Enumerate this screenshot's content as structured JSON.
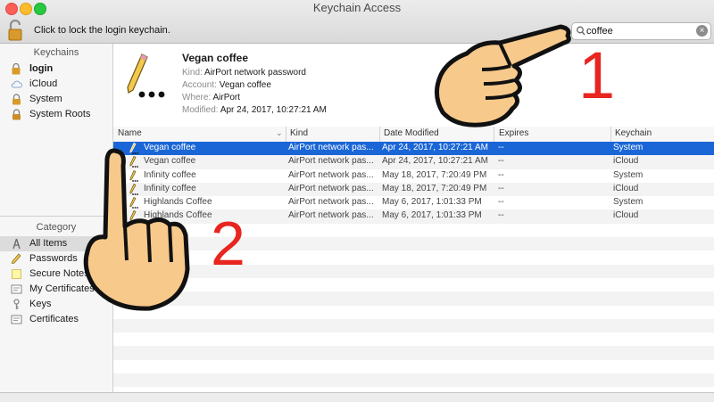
{
  "window": {
    "title": "Keychain Access"
  },
  "toolbar": {
    "lock_message": "Click to lock the login keychain."
  },
  "search": {
    "value": "coffee",
    "icon": "magnifier-icon"
  },
  "sidebar": {
    "keychains_header": "Keychains",
    "keychains": [
      {
        "label": "login",
        "icon": "keychain-icon",
        "bold": true
      },
      {
        "label": "iCloud",
        "icon": "cloud-icon"
      },
      {
        "label": "System",
        "icon": "lock-icon"
      },
      {
        "label": "System Roots",
        "icon": "lock-icon"
      }
    ],
    "category_header": "Category",
    "categories": [
      {
        "label": "All Items",
        "icon": "all-items-icon",
        "selected": true
      },
      {
        "label": "Passwords",
        "icon": "pencil-icon"
      },
      {
        "label": "Secure Notes",
        "icon": "note-icon"
      },
      {
        "label": "My Certificates",
        "icon": "certificate-icon"
      },
      {
        "label": "Keys",
        "icon": "key-icon"
      },
      {
        "label": "Certificates",
        "icon": "certificate-icon"
      }
    ]
  },
  "detail": {
    "name": "Vegan coffee",
    "kind_label": "Kind:",
    "kind": "AirPort network password",
    "account_label": "Account:",
    "account": "Vegan coffee",
    "where_label": "Where:",
    "where": "AirPort",
    "modified_label": "Modified:",
    "modified": "Apr 24, 2017, 10:27:21 AM"
  },
  "table": {
    "columns": [
      "Name",
      "Kind",
      "Date Modified",
      "Expires",
      "Keychain"
    ],
    "rows": [
      {
        "name": "Vegan coffee",
        "kind": "AirPort network pas...",
        "date": "Apr 24, 2017, 10:27:21 AM",
        "expires": "--",
        "keychain": "System"
      },
      {
        "name": "Vegan coffee",
        "kind": "AirPort network pas...",
        "date": "Apr 24, 2017, 10:27:21 AM",
        "expires": "--",
        "keychain": "iCloud"
      },
      {
        "name": "Infinity coffee",
        "kind": "AirPort network pas...",
        "date": "May 18, 2017, 7:20:49 PM",
        "expires": "--",
        "keychain": "System"
      },
      {
        "name": "Infinity coffee",
        "kind": "AirPort network pas...",
        "date": "May 18, 2017, 7:20:49 PM",
        "expires": "--",
        "keychain": "iCloud"
      },
      {
        "name": "Highlands Coffee",
        "kind": "AirPort network pas...",
        "date": "May 6, 2017, 1:01:33 PM",
        "expires": "--",
        "keychain": "System"
      },
      {
        "name": "Highlands Coffee",
        "kind": "AirPort network pas...",
        "date": "May 6, 2017, 1:01:33 PM",
        "expires": "--",
        "keychain": "iCloud"
      }
    ]
  },
  "annotations": {
    "step1": "1",
    "step2": "2",
    "color": "#e8251f",
    "hand_color": "#f7c98b"
  },
  "colors": {
    "selection": "#1a66d6",
    "close": "#fc5f57",
    "minimize": "#fdbc2e",
    "zoom": "#28c840"
  }
}
